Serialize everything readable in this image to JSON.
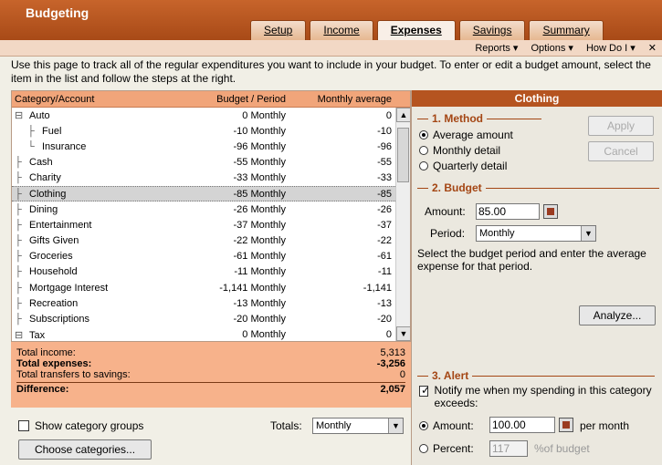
{
  "app": {
    "title": "Budgeting"
  },
  "tabs": [
    "Setup",
    "Income",
    "Expenses",
    "Savings",
    "Summary"
  ],
  "toolbar": {
    "reports": "Reports ▾",
    "options": "Options ▾",
    "howdoi": "How Do I ▾",
    "close": "✕"
  },
  "instructions": "Use this page to track all of the regular expenditures you want to include in your budget. To enter or edit a budget amount, select the item in the list and follow the steps at the right.",
  "list": {
    "headers": {
      "category": "Category/Account",
      "budget": "Budget / Period",
      "avg": "Monthly average"
    },
    "rows": [
      {
        "category": "Auto",
        "budget": "0 Monthly",
        "avg": "0",
        "tree": "⊟"
      },
      {
        "category": "Fuel",
        "budget": "-10 Monthly",
        "avg": "-10",
        "tree": "├"
      },
      {
        "category": "Insurance",
        "budget": "-96 Monthly",
        "avg": "-96",
        "tree": "└"
      },
      {
        "category": "Cash",
        "budget": "-55 Monthly",
        "avg": "-55",
        "tree": "├"
      },
      {
        "category": "Charity",
        "budget": "-33 Monthly",
        "avg": "-33",
        "tree": "├"
      },
      {
        "category": "Clothing",
        "budget": "-85 Monthly",
        "avg": "-85",
        "tree": "├"
      },
      {
        "category": "Dining",
        "budget": "-26 Monthly",
        "avg": "-26",
        "tree": "├"
      },
      {
        "category": "Entertainment",
        "budget": "-37 Monthly",
        "avg": "-37",
        "tree": "├"
      },
      {
        "category": "Gifts Given",
        "budget": "-22 Monthly",
        "avg": "-22",
        "tree": "├"
      },
      {
        "category": "Groceries",
        "budget": "-61 Monthly",
        "avg": "-61",
        "tree": "├"
      },
      {
        "category": "Household",
        "budget": "-11 Monthly",
        "avg": "-11",
        "tree": "├"
      },
      {
        "category": "Mortgage Interest",
        "budget": "-1,141 Monthly",
        "avg": "-1,141",
        "tree": "├"
      },
      {
        "category": "Recreation",
        "budget": "-13 Monthly",
        "avg": "-13",
        "tree": "├"
      },
      {
        "category": "Subscriptions",
        "budget": "-20 Monthly",
        "avg": "-20",
        "tree": "├"
      },
      {
        "category": "Tax",
        "budget": "0 Monthly",
        "avg": "0",
        "tree": "⊟"
      }
    ],
    "selected_index": 5
  },
  "totals": {
    "income_label": "Total income:",
    "income": "5,313",
    "expenses_label": "Total expenses:",
    "expenses": "-3,256",
    "savings_label": "Total transfers to savings:",
    "savings": "0",
    "diff_label": "Difference:",
    "diff": "2,057"
  },
  "bottom": {
    "show_groups": "Show category groups",
    "totals_label": "Totals:",
    "totals_value": "Monthly",
    "choose_btn": "Choose categories..."
  },
  "panel": {
    "title": "Clothing",
    "method_title": "1. Method",
    "method_options": [
      "Average amount",
      "Monthly detail",
      "Quarterly detail"
    ],
    "apply": "Apply",
    "cancel": "Cancel",
    "budget_title": "2. Budget",
    "amount_label": "Amount:",
    "amount_value": "85.00",
    "period_label": "Period:",
    "period_value": "Monthly",
    "help_text": "Select the budget period and enter the average expense for that period.",
    "analyze": "Analyze...",
    "alert_title": "3. Alert",
    "notify_text": "Notify me when my spending in this category exceeds:",
    "alert_amount_label": "Amount:",
    "alert_amount_value": "100.00",
    "per_month": "per month",
    "percent_label": "Percent:",
    "percent_value": "117",
    "of_budget": "%of budget"
  }
}
